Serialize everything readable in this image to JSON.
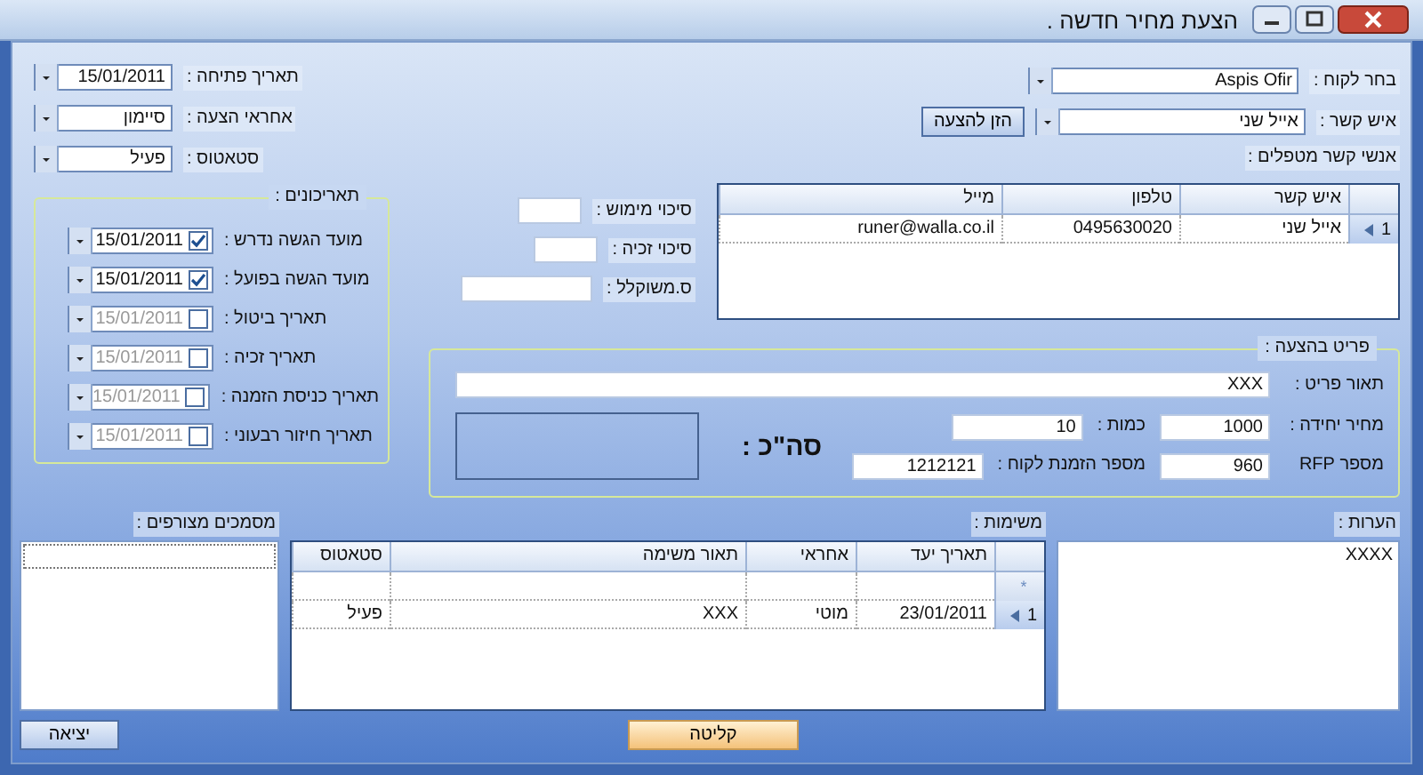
{
  "window": {
    "title": "הצעת מחיר חדשה ."
  },
  "header_fields": [
    {
      "label": "תאריך פתיחה :",
      "value": "15/01/2011"
    },
    {
      "label": "אחראי הצעה :",
      "value": "סיימון"
    },
    {
      "label": "סטאטוס :",
      "value": "פעיל"
    }
  ],
  "dates_group": {
    "title": "תאריכונים :",
    "rows": [
      {
        "label": "מועד הגשה נדרש :",
        "value": "15/01/2011",
        "checked": true
      },
      {
        "label": "מועד הגשה בפועל :",
        "value": "15/01/2011",
        "checked": true
      },
      {
        "label": "תאריך ביטול :",
        "value": "15/01/2011",
        "checked": false
      },
      {
        "label": "תאריך זכיה :",
        "value": "15/01/2011",
        "checked": false
      },
      {
        "label": "תאריך כניסת הזמנה :",
        "value": "15/01/2011",
        "checked": false
      },
      {
        "label": "תאריך חיזור רבעוני :",
        "value": "15/01/2011",
        "checked": false
      }
    ]
  },
  "finance_fields": [
    {
      "label": "סיכוי מימוש :"
    },
    {
      "label": "סיכוי זכיה :"
    },
    {
      "label": "ס.משוקלל :"
    }
  ],
  "customer": {
    "label": "בחר לקוח :",
    "value": "Aspis Ofir"
  },
  "contact": {
    "label": "איש קשר :",
    "value": "אייל שני",
    "button": "הזן להצעה"
  },
  "contacts_grid": {
    "title": "אנשי קשר מטפלים :",
    "columns": [
      "איש קשר",
      "טלפון",
      "מייל"
    ],
    "rows": [
      {
        "index": "1",
        "selected": true,
        "cells": [
          "אייל שני",
          "0495630020",
          "runer@walla.co.il"
        ]
      }
    ]
  },
  "item_group": {
    "title": "פריט בהצעה :",
    "description_label": "תאור פריט :",
    "description": "XXX",
    "total_label": "סה\"כ :",
    "fields": [
      {
        "label": "מחיר יחידה :",
        "value": "1000"
      },
      {
        "label": "כמות :",
        "value": "10"
      },
      {
        "label": "מספר RFP",
        "value": "960"
      },
      {
        "label": "מספר הזמנת לקוח :",
        "value": "1212121"
      }
    ]
  },
  "attachments": {
    "title": "מסמכים מצורפים :"
  },
  "tasks_grid": {
    "title": "משימות :",
    "new_row_marker": "*",
    "columns": [
      "תאריך יעד",
      "אחראי",
      "תאור משימה",
      "סטאטוס"
    ],
    "rows": [
      {
        "index": "1",
        "selected": true,
        "cells": [
          "23/01/2011",
          "מוטי",
          "XXX",
          "פעיל"
        ]
      }
    ]
  },
  "notes": {
    "title": "הערות :",
    "text": "XXXX"
  },
  "buttons": {
    "exit": "יציאה",
    "save": "קליטה"
  }
}
